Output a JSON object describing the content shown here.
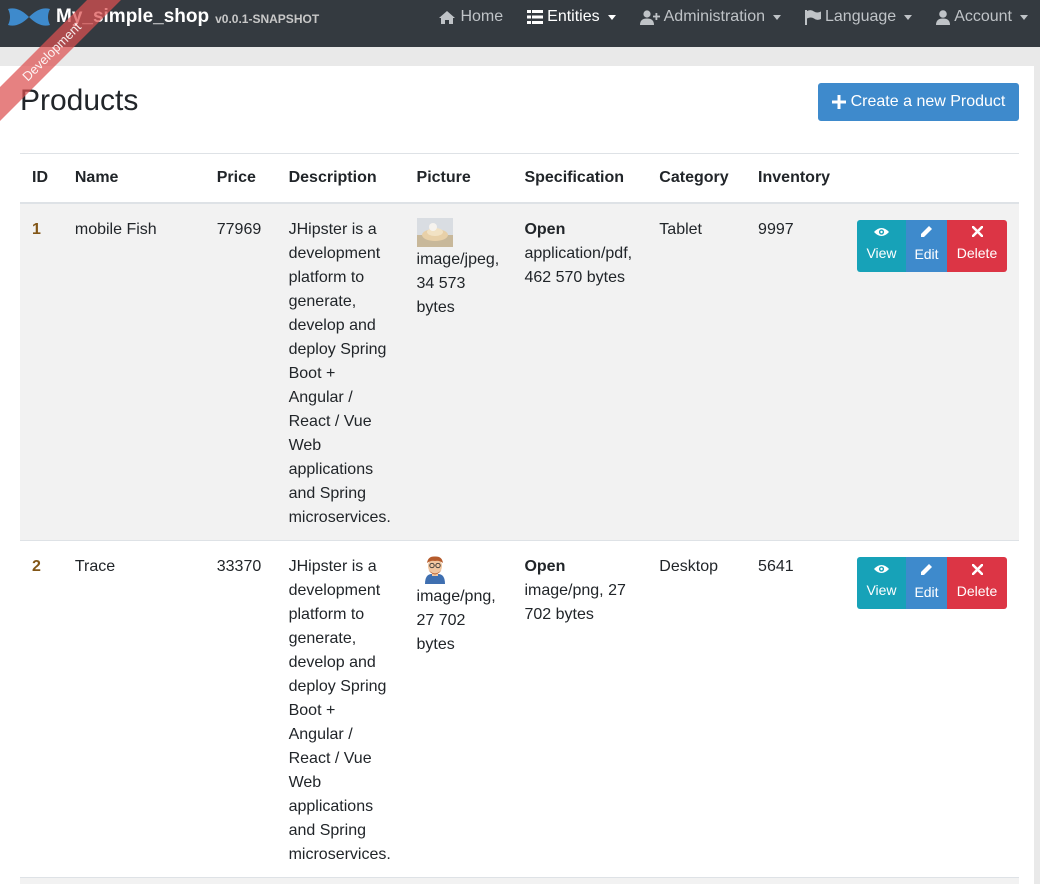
{
  "navbar": {
    "brand_name": "My_simple_shop",
    "version": "v0.0.1-SNAPSHOT",
    "items": [
      {
        "label": "Home",
        "icon": "home-icon"
      },
      {
        "label": "Entities",
        "icon": "list-icon",
        "active": true
      },
      {
        "label": "Administration",
        "icon": "user-plus-icon"
      },
      {
        "label": "Language",
        "icon": "flag-icon"
      },
      {
        "label": "Account",
        "icon": "user-icon"
      }
    ]
  },
  "ribbon": {
    "label": "Development"
  },
  "page": {
    "title": "Products",
    "create_label": "Create a new Product"
  },
  "table": {
    "headers": [
      "ID",
      "Name",
      "Price",
      "Description",
      "Picture",
      "Specification",
      "Category",
      "Inventory"
    ],
    "rows": [
      {
        "id": "1",
        "name": "mobile Fish",
        "price": "77969",
        "description": "JHipster is a development platform to generate, develop and deploy Spring Boot + Angular / React / Vue Web applications and Spring microservices.",
        "picture_info": "image/jpeg, 34 573 bytes",
        "spec_link": "Open",
        "spec_info": "application/pdf, 462 570 bytes",
        "category": "Tablet",
        "inventory": "9997"
      },
      {
        "id": "2",
        "name": "Trace",
        "price": "33370",
        "description": "JHipster is a development platform to generate, develop and deploy Spring Boot + Angular / React / Vue Web applications and Spring microservices.",
        "picture_info": "image/png, 27 702 bytes",
        "spec_link": "Open",
        "spec_info": "image/png, 27 702 bytes",
        "category": "Desktop",
        "inventory": "5641"
      }
    ],
    "actions": {
      "view": "View",
      "edit": "Edit",
      "delete": "Delete"
    }
  },
  "colors": {
    "navbar": "#343a40",
    "primary": "#3e8acc",
    "info": "#17a2b8",
    "danger": "#dc3545",
    "id_link": "#825617"
  }
}
